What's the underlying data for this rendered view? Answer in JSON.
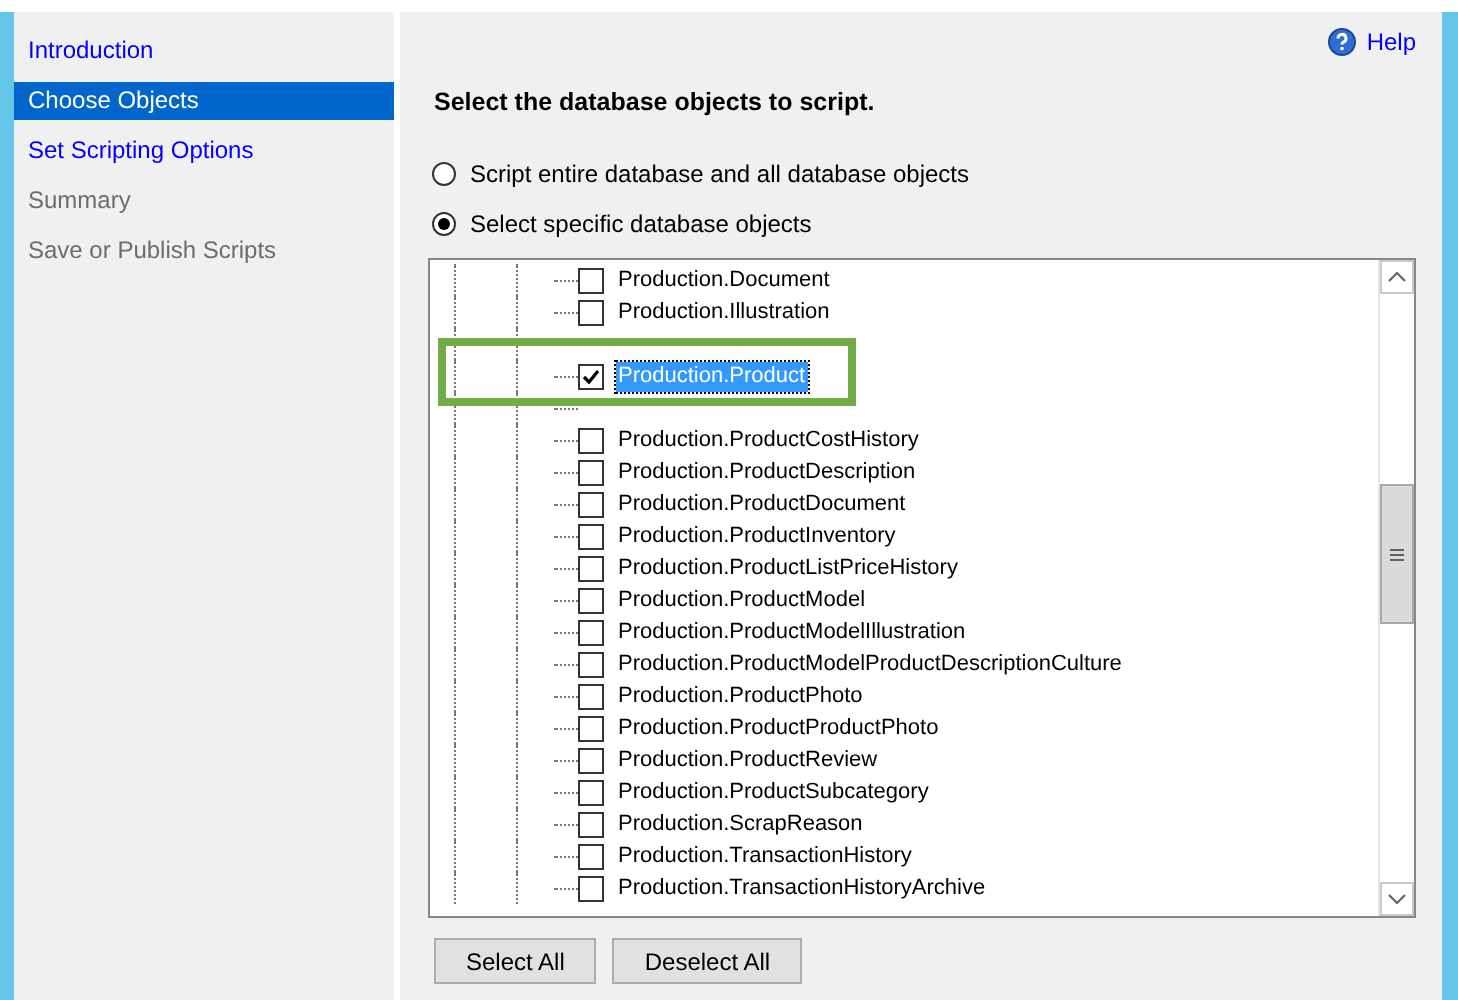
{
  "sidebar": {
    "items": [
      {
        "label": "Introduction",
        "selected": false,
        "kind": "link"
      },
      {
        "label": "Choose Objects",
        "selected": true,
        "kind": "link"
      },
      {
        "label": "Set Scripting Options",
        "selected": false,
        "kind": "link"
      },
      {
        "label": "Summary",
        "selected": false,
        "kind": "disabled"
      },
      {
        "label": "Save or Publish Scripts",
        "selected": false,
        "kind": "disabled"
      }
    ]
  },
  "help": {
    "label": "Help"
  },
  "heading": "Select the database objects to script.",
  "options": [
    {
      "label": "Script entire database and all database objects",
      "selected": false
    },
    {
      "label": "Select specific database objects",
      "selected": true
    }
  ],
  "objects": [
    {
      "label": "Production.Document",
      "checked": false,
      "selected": false
    },
    {
      "label": "Production.Illustration",
      "checked": false,
      "selected": false
    },
    {
      "kind": "covered"
    },
    {
      "label": "Production.Product",
      "checked": true,
      "selected": true
    },
    {
      "kind": "covered"
    },
    {
      "label": "Production.ProductCostHistory",
      "checked": false,
      "selected": false
    },
    {
      "label": "Production.ProductDescription",
      "checked": false,
      "selected": false
    },
    {
      "label": "Production.ProductDocument",
      "checked": false,
      "selected": false
    },
    {
      "label": "Production.ProductInventory",
      "checked": false,
      "selected": false
    },
    {
      "label": "Production.ProductListPriceHistory",
      "checked": false,
      "selected": false
    },
    {
      "label": "Production.ProductModel",
      "checked": false,
      "selected": false
    },
    {
      "label": "Production.ProductModelIllustration",
      "checked": false,
      "selected": false
    },
    {
      "label": "Production.ProductModelProductDescriptionCulture",
      "checked": false,
      "selected": false
    },
    {
      "label": "Production.ProductPhoto",
      "checked": false,
      "selected": false
    },
    {
      "label": "Production.ProductProductPhoto",
      "checked": false,
      "selected": false
    },
    {
      "label": "Production.ProductReview",
      "checked": false,
      "selected": false
    },
    {
      "label": "Production.ProductSubcategory",
      "checked": false,
      "selected": false
    },
    {
      "label": "Production.ScrapReason",
      "checked": false,
      "selected": false
    },
    {
      "label": "Production.TransactionHistory",
      "checked": false,
      "selected": false
    },
    {
      "label": "Production.TransactionHistoryArchive",
      "checked": false,
      "selected": false
    }
  ],
  "buttons": [
    "Select All",
    "Deselect All"
  ]
}
